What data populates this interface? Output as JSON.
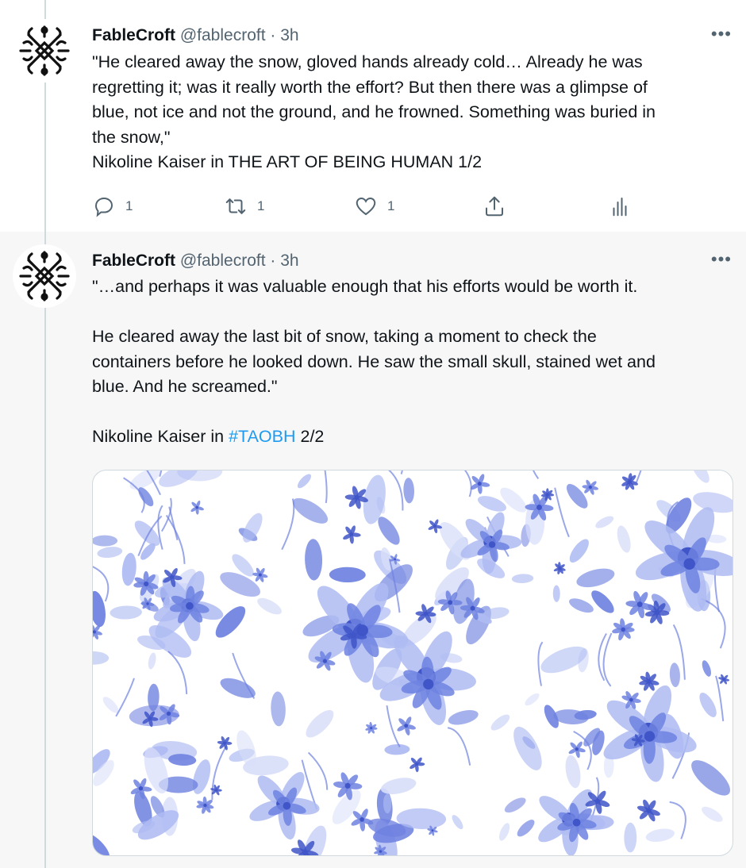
{
  "tweets": [
    {
      "author_name": "FableCroft",
      "handle": "@fablecroft",
      "separator": "·",
      "time": "3h",
      "more_label": "•••",
      "lines": [
        "\"He cleared away the snow, gloved hands already cold… Already he was",
        "regretting it; was it really worth the effort? But then there was a glimpse of",
        "blue, not ice and not the ground, and he frowned. Something was buried in",
        "the snow,\"",
        "Nikoline Kaiser in THE ART OF BEING HUMAN 1/2"
      ],
      "actions": {
        "reply_count": "1",
        "retweet_count": "1",
        "like_count": "1"
      },
      "icons": [
        "reply-icon",
        "retweet-icon",
        "like-icon",
        "share-icon",
        "analytics-icon"
      ]
    },
    {
      "author_name": "FableCroft",
      "handle": "@fablecroft",
      "separator": "·",
      "time": "3h",
      "more_label": "•••",
      "para1": "\"…and perhaps it was valuable enough that his efforts would be worth it.",
      "para2_lines": [
        "He cleared away the last bit of snow, taking a moment to check the",
        "containers before he looked down. He saw the small skull, stained wet and",
        "blue. And he screamed.\""
      ],
      "para3_prefix": "Nikoline Kaiser in ",
      "hashtag": "#TAOBH",
      "para3_suffix": " 2/2",
      "media": {
        "type": "image",
        "description_icon": "blue-floral-pattern",
        "colors": {
          "dark": "#3f55c8",
          "mid": "#6f82e0",
          "light": "#aebbf2",
          "pale": "#d8def9"
        }
      }
    }
  ],
  "colors": {
    "text": "#0f1419",
    "secondary": "#536471",
    "link": "#1d9bf0",
    "thread_line": "#cfd9de",
    "second_bg": "#f7f7f7"
  }
}
